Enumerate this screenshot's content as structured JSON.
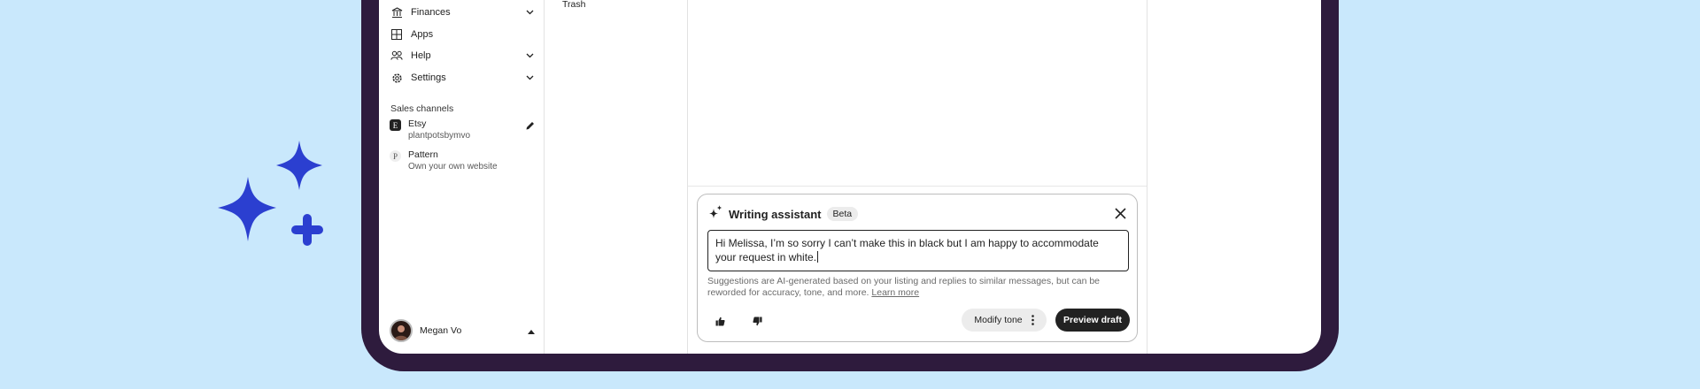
{
  "colors": {
    "background": "#c9e8fc",
    "device_frame": "#2e1b3d",
    "sparkle": "#2b3fd0",
    "primary_button": "#222222"
  },
  "sidebar": {
    "nav_items": [
      {
        "label": "Finances",
        "icon": "bank-icon",
        "has_chevron": true
      },
      {
        "label": "Apps",
        "icon": "grid-icon",
        "has_chevron": false
      },
      {
        "label": "Help",
        "icon": "people-icon",
        "has_chevron": true
      },
      {
        "label": "Settings",
        "icon": "gear-icon",
        "has_chevron": true
      }
    ],
    "sales_channels_title": "Sales channels",
    "channels": [
      {
        "badge": "E",
        "name": "Etsy",
        "sub": "plantpotsbymvo"
      },
      {
        "badge": "P",
        "name": "Pattern",
        "sub": "Own your own website"
      }
    ],
    "user": {
      "name": "Megan Vo"
    }
  },
  "folders": {
    "trash_label": "Trash"
  },
  "assistant": {
    "title": "Writing assistant",
    "badge": "Beta",
    "draft_text": "Hi Melissa, I’m so sorry I can’t make this in black but I am happy to accommodate your request in white.",
    "disclaimer": "Suggestions are AI-generated based on your listing and replies to similar messages, but can be reworded for accuracy, tone, and more. ",
    "learn_more": "Learn more",
    "modify_tone_label": "Modify tone",
    "preview_label": "Preview draft"
  }
}
